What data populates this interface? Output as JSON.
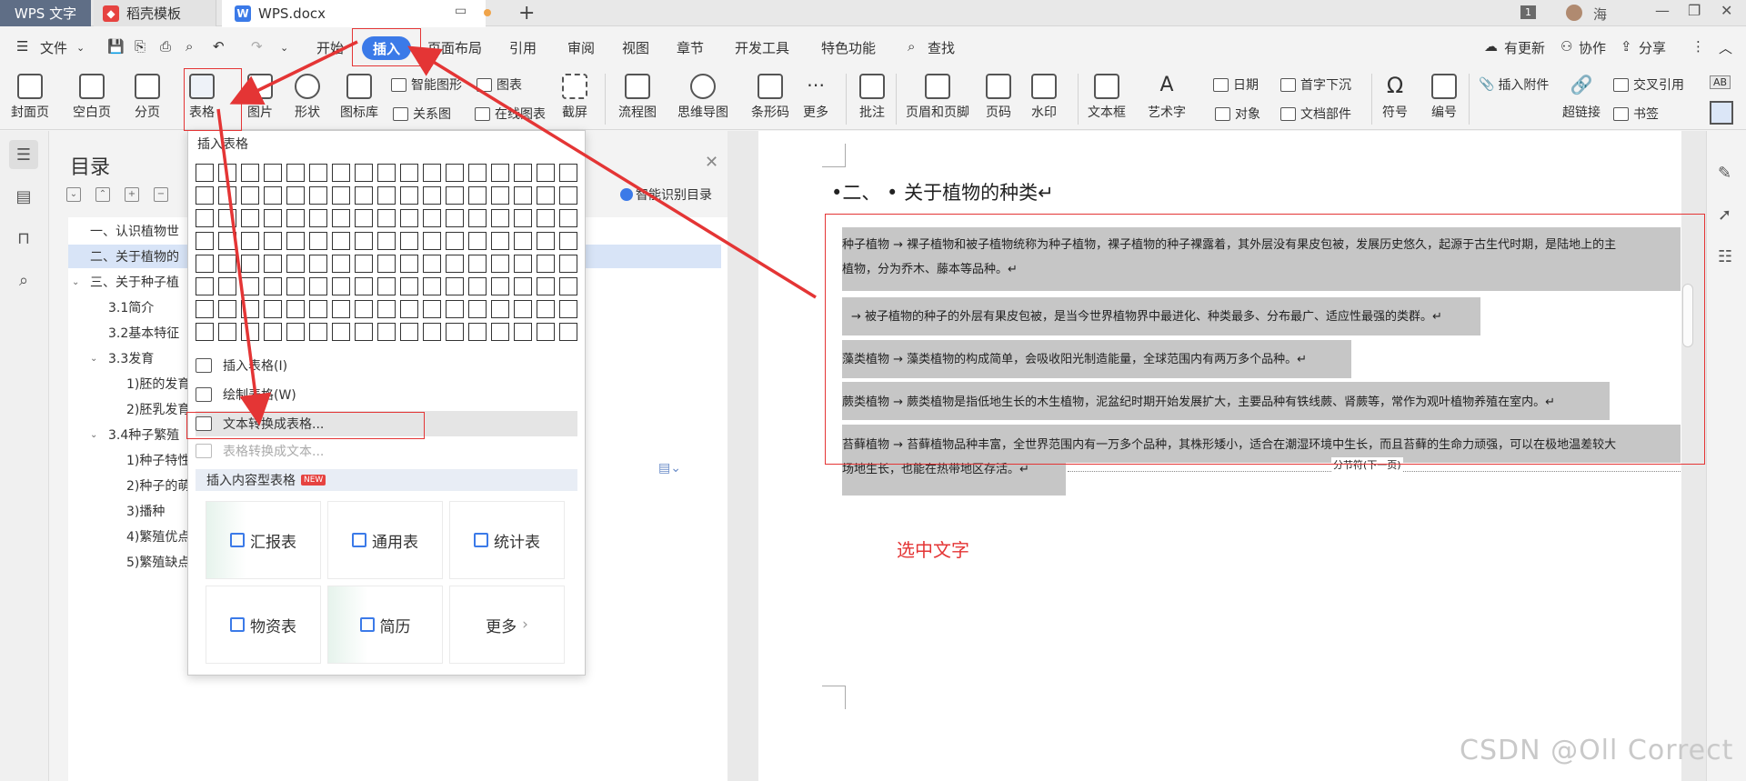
{
  "titlebar": {
    "wps_tab": "WPS 文字",
    "daoke_tab": "稻壳模板",
    "doc_tab": "WPS.docx",
    "page_count": "1",
    "user": "海"
  },
  "menubar": {
    "file": "文件",
    "items": [
      "开始",
      "插入",
      "页面布局",
      "引用",
      "审阅",
      "视图",
      "章节",
      "开发工具",
      "特色功能"
    ],
    "search": "查找",
    "right": [
      "有更新",
      "协作",
      "分享"
    ]
  },
  "ribbon": {
    "cover": "封面页",
    "blank": "空白页",
    "page_break": "分页",
    "table": "表格",
    "picture": "图片",
    "shape": "形状",
    "icon_lib": "图标库",
    "smart_graphic": "智能图形",
    "chart": "图表",
    "relation": "关系图",
    "online_chart": "在线图表",
    "screenshot": "截屏",
    "flowchart": "流程图",
    "mindmap": "思维导图",
    "barcode": "条形码",
    "more": "更多",
    "comment": "批注",
    "header_footer": "页眉和页脚",
    "page_num": "页码",
    "watermark": "水印",
    "textbox": "文本框",
    "wordart": "艺术字",
    "date": "日期",
    "object": "对象",
    "drop_cap": "首字下沉",
    "doc_parts": "文档部件",
    "symbol": "符号",
    "numbering": "编号",
    "attachment": "插入附件",
    "cross_ref": "交叉引用",
    "hyperlink": "超链接",
    "bookmark": "书签",
    "ab": "AB"
  },
  "toc": {
    "title": "目录",
    "smart": "智能识别目录",
    "items": [
      {
        "label": "一、认识植物世",
        "level": 0,
        "arrow": ""
      },
      {
        "label": "二、关于植物的",
        "level": 0,
        "arrow": "",
        "selected": true
      },
      {
        "label": "三、关于种子植",
        "level": 0,
        "arrow": "⌄"
      },
      {
        "label": "3.1简介",
        "level": 1,
        "arrow": ""
      },
      {
        "label": "3.2基本特征",
        "level": 1,
        "arrow": ""
      },
      {
        "label": "3.3发育",
        "level": 1,
        "arrow": "⌄"
      },
      {
        "label": "1)胚的发育",
        "level": 2,
        "arrow": ""
      },
      {
        "label": "2)胚乳发育",
        "level": 2,
        "arrow": ""
      },
      {
        "label": "3.4种子繁殖",
        "level": 1,
        "arrow": "⌄"
      },
      {
        "label": "1)种子特性",
        "level": 2,
        "arrow": ""
      },
      {
        "label": "2)种子的萌",
        "level": 2,
        "arrow": ""
      },
      {
        "label": "3)播种",
        "level": 2,
        "arrow": ""
      },
      {
        "label": "4)繁殖优点",
        "level": 2,
        "arrow": ""
      },
      {
        "label": "5)繁殖缺点",
        "level": 2,
        "arrow": ""
      }
    ]
  },
  "dropdown": {
    "title": "插入表格",
    "items": [
      "插入表格(I)",
      "绘制表格(W)",
      "文本转换成表格...",
      "表格转换成文本..."
    ],
    "section": "插入内容型表格",
    "new_badge": "NEW",
    "cards": [
      "汇报表",
      "通用表",
      "统计表",
      "物资表",
      "简历",
      "更多"
    ]
  },
  "document": {
    "heading": "•二、 • 关于植物的种类↵",
    "lines": [
      "种子植物  →  裸子植物和被子植物统称为种子植物，裸子植物的种子裸露着，其外层没有果皮包被，发展历史悠久，起源于古生代时期，是陆地上的主",
      "植物，分为乔木、藤本等品种。↵",
      "→  被子植物的种子的外层有果皮包被，是当今世界植物界中最进化、种类最多、分布最广、适应性最强的类群。↵",
      "藻类植物  →  藻类植物的构成简单，会吸收阳光制造能量，全球范围内有两万多个品种。↵",
      "蕨类植物  →  蕨类植物是指低地生长的木生植物，泥盆纪时期开始发展扩大，主要品种有铁线蕨、肾蕨等，常作为观叶植物养殖在室内。↵",
      "苔藓植物  →  苔藓植物品种丰富，全世界范围内有一万多个品种，其株形矮小，适合在潮湿环境中生长，而且苔藓的生命力顽强，可以在极地温差较大",
      "场地生长，也能在热带地区存活。↵"
    ],
    "section_break": "分节符(下一页)",
    "annotation": "选中文字"
  },
  "watermark": "CSDN @Oll Correct"
}
